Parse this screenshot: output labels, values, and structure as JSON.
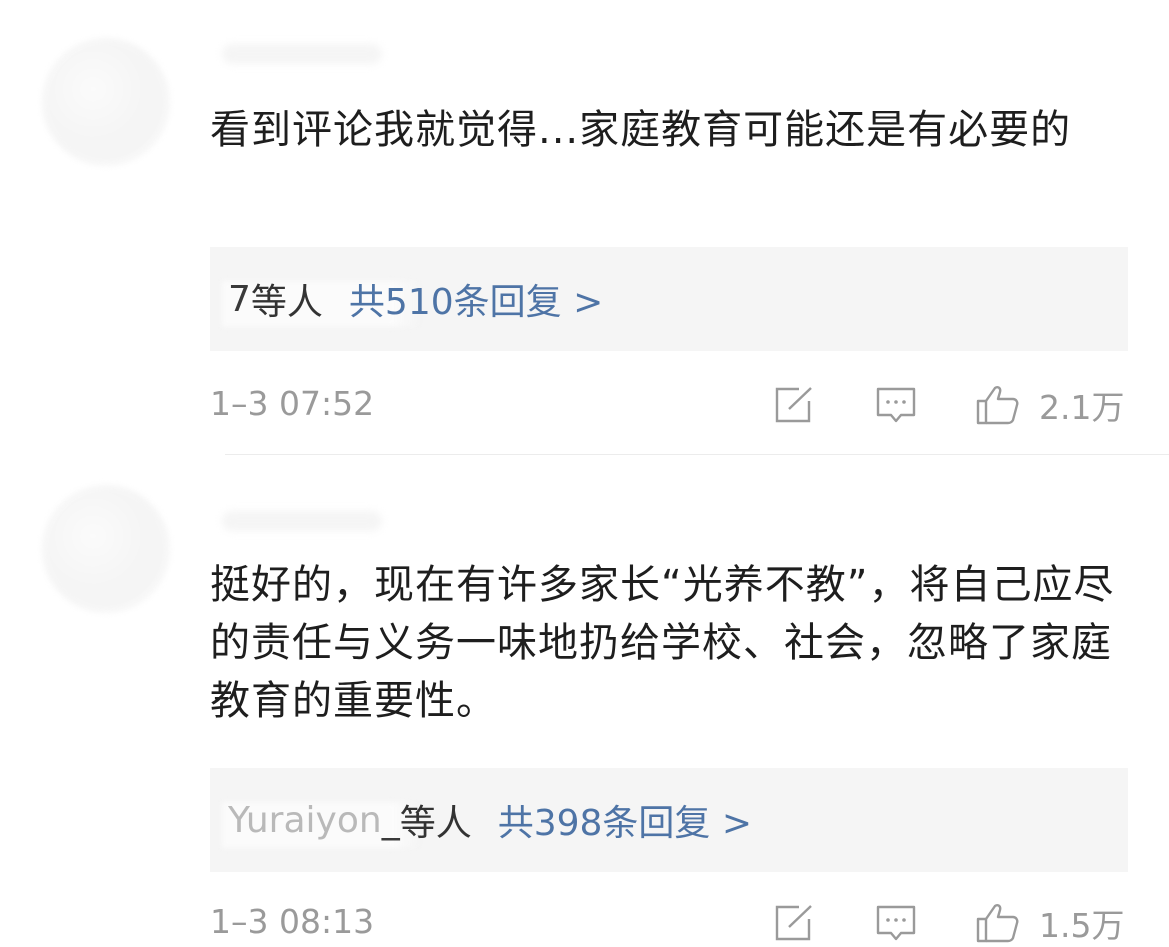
{
  "comments": [
    {
      "text": "看到评论我就觉得...家庭教育可能还是有必要的",
      "replies": {
        "users_masked": "",
        "users_visible": "7",
        "suffix": "等人",
        "count_label": "共510条回复 >"
      },
      "timestamp": "1–3 07:52",
      "like_count": "2.1万"
    },
    {
      "text": "挺好的，现在有许多家长“光养不教”，将自己应尽的责任与义务一味地扔给学校、社会，忽略了家庭教育的重要性。",
      "replies": {
        "users_masked": "Yuraiyon",
        "users_visible": "_",
        "suffix": "等人",
        "count_label": "共398条回复 >"
      },
      "timestamp": "1–3 08:13",
      "like_count": "1.5万"
    }
  ],
  "icons": {
    "share": "edit-share-icon",
    "comment": "comment-bubble-icon",
    "like": "thumbs-up-icon"
  },
  "colors": {
    "reply_link": "#4e74a6",
    "meta_gray": "#9a9a9a",
    "reply_box_bg": "#f5f5f5"
  }
}
